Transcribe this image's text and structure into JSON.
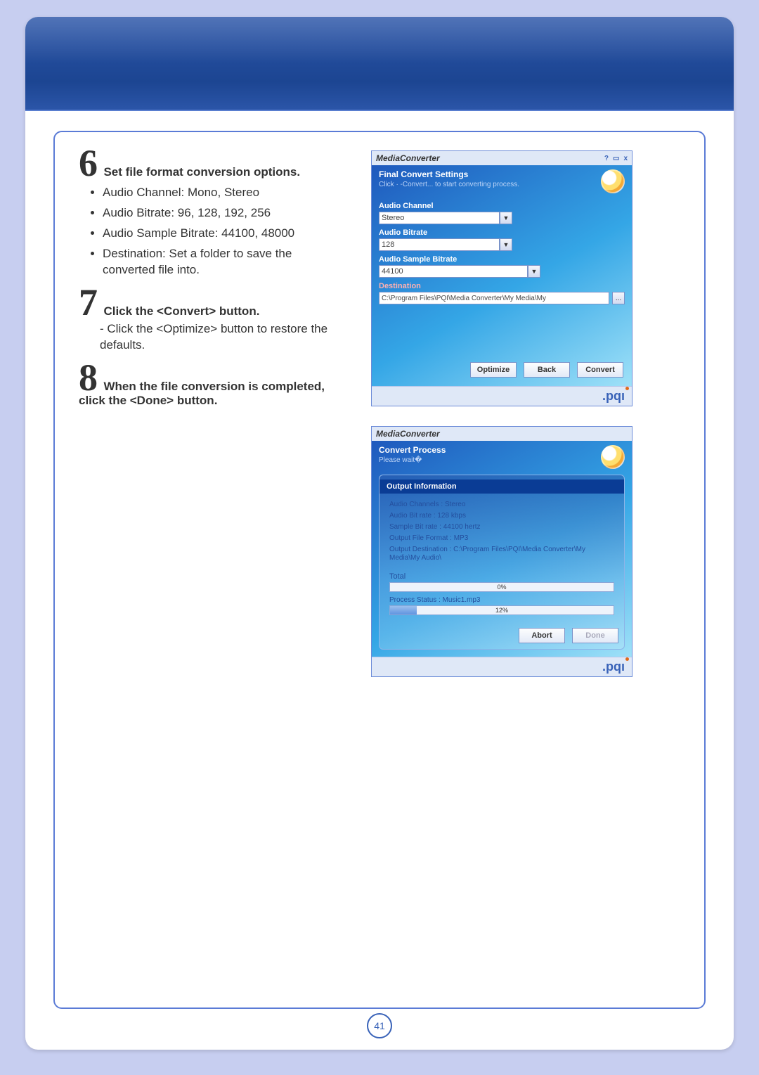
{
  "page_number": "41",
  "steps": {
    "s6": {
      "num": "6",
      "title": "Set file format conversion options.",
      "bullets": [
        "Audio Channel: Mono, Stereo",
        "Audio Bitrate: 96, 128, 192, 256",
        "Audio Sample Bitrate: 44100, 48000",
        "Destination: Set a folder to save the converted file into."
      ]
    },
    "s7": {
      "num": "7",
      "title": "Click the <Convert> button.",
      "note": "- Click the <Optimize> button to restore the defaults."
    },
    "s8": {
      "num": "8",
      "title": "When the file conversion is completed, click the <Done> button."
    }
  },
  "window1": {
    "app_title": "MediaConverter",
    "help": "?",
    "min": "▭",
    "close": "x",
    "head_title": "Final Convert Settings",
    "head_sub": "Click · -Convert... to start converting process.",
    "labels": {
      "channel": "Audio Channel",
      "bitrate": "Audio Bitrate",
      "sample": "Audio Sample Bitrate",
      "dest": "Destination"
    },
    "values": {
      "channel": "Stereo",
      "bitrate": "128",
      "sample": "44100",
      "dest": "C:\\Program Files\\PQI\\Media Converter\\My Media\\My"
    },
    "browse": "...",
    "buttons": {
      "optimize": "Optimize",
      "back": "Back",
      "convert": "Convert"
    },
    "logo": ".pqı"
  },
  "window2": {
    "app_title": "MediaConverter",
    "head_title": "Convert Process",
    "head_sub": "Please wait�",
    "section": "Output Information",
    "info": {
      "channels": "Audio Channels : Stereo",
      "bitrate": "Audio Bit rate : 128 kbps",
      "sample": "Sample Bit rate : 44100 hertz",
      "format": "Output File Format : MP3",
      "dest": "Output Destination : C:\\Program Files\\PQI\\Media Converter\\My Media\\My Audio\\"
    },
    "total_label": "Total",
    "total_pct": "0%",
    "process_status": "Process Status : Music1.mp3",
    "proc_pct": "12%",
    "buttons": {
      "abort": "Abort",
      "done": "Done"
    },
    "logo": ".pqı"
  }
}
